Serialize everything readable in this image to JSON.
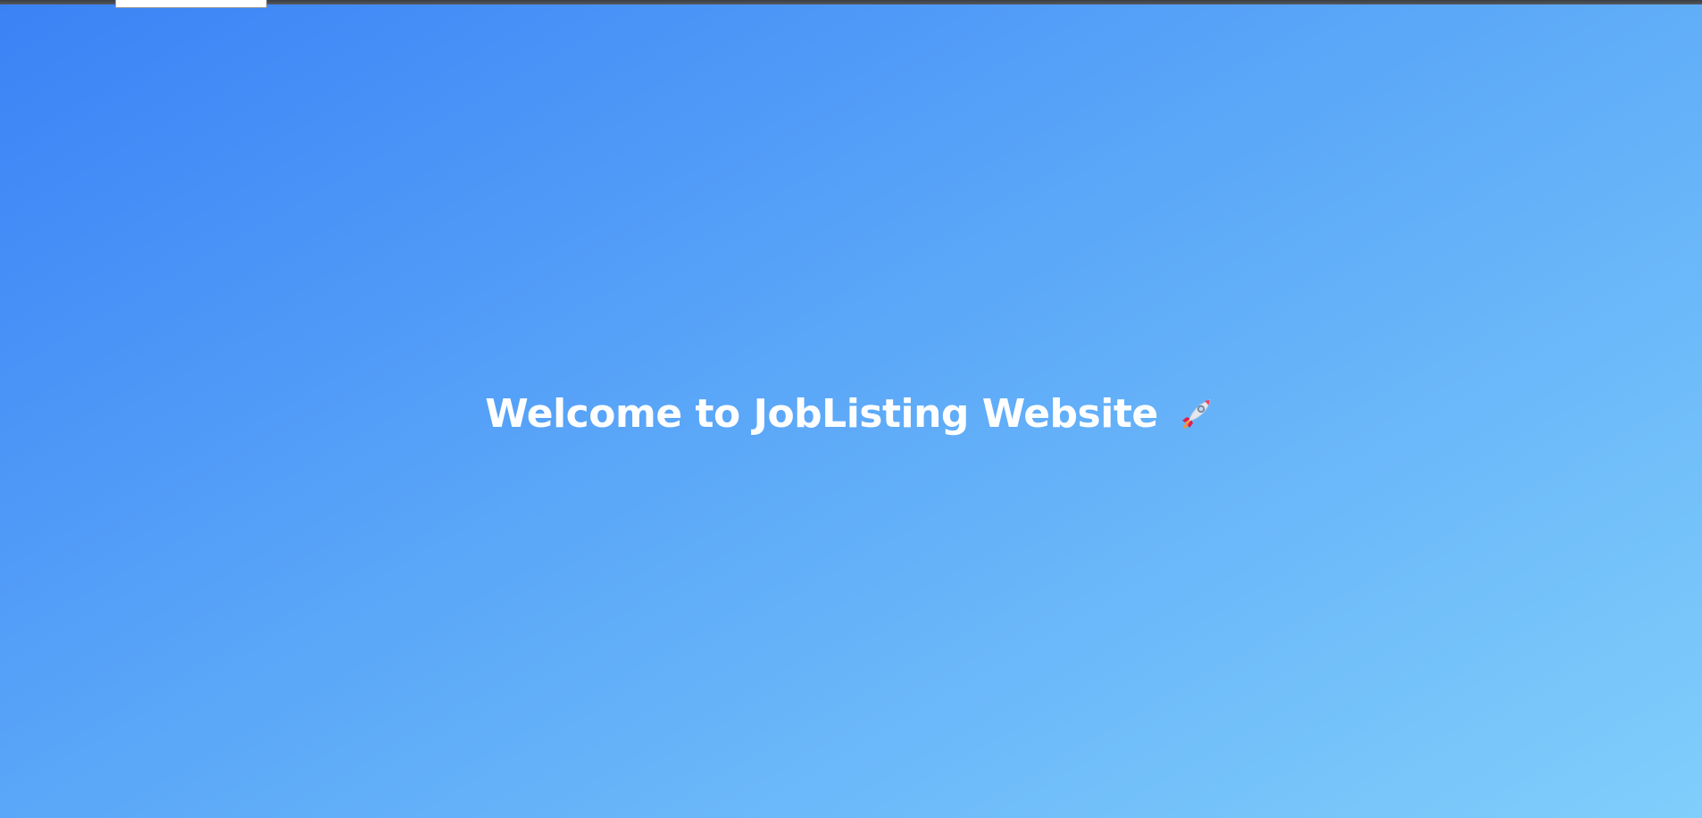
{
  "hero": {
    "title": "Welcome to JobListing Website",
    "icon": "rocket-icon"
  },
  "colors": {
    "gradient_start": "#3b82f6",
    "gradient_end": "#80cefb",
    "title_color": "#ffffff"
  }
}
